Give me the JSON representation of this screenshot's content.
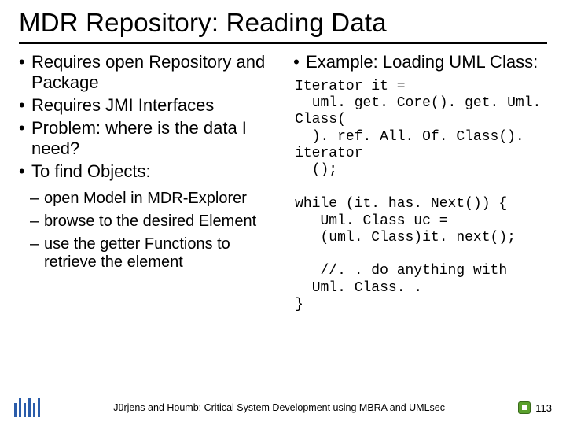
{
  "title": "MDR Repository: Reading Data",
  "left": {
    "bullets": [
      "Requires open Repository and Package",
      "Requires JMI Interfaces",
      "Problem: where is the data I need?",
      "To find Objects:"
    ],
    "sub": [
      "open Model in MDR-Explorer",
      "browse to the desired Element",
      "use the getter Functions to retrieve the element"
    ]
  },
  "right": {
    "bullets": [
      "Example: Loading UML Class:"
    ],
    "code1": "Iterator it =\n  uml. get. Core(). get. Uml. Class(\n  ). ref. All. Of. Class(). iterator\n  ();",
    "code2": "while (it. has. Next()) {\n   Uml. Class uc =\n   (uml. Class)it. next();\n\n   //. . do anything with\n  Uml. Class. .\n}"
  },
  "footer": {
    "text": "Jürjens and Houmb: Critical System Development using MBRA and UMLsec",
    "page": "113"
  }
}
